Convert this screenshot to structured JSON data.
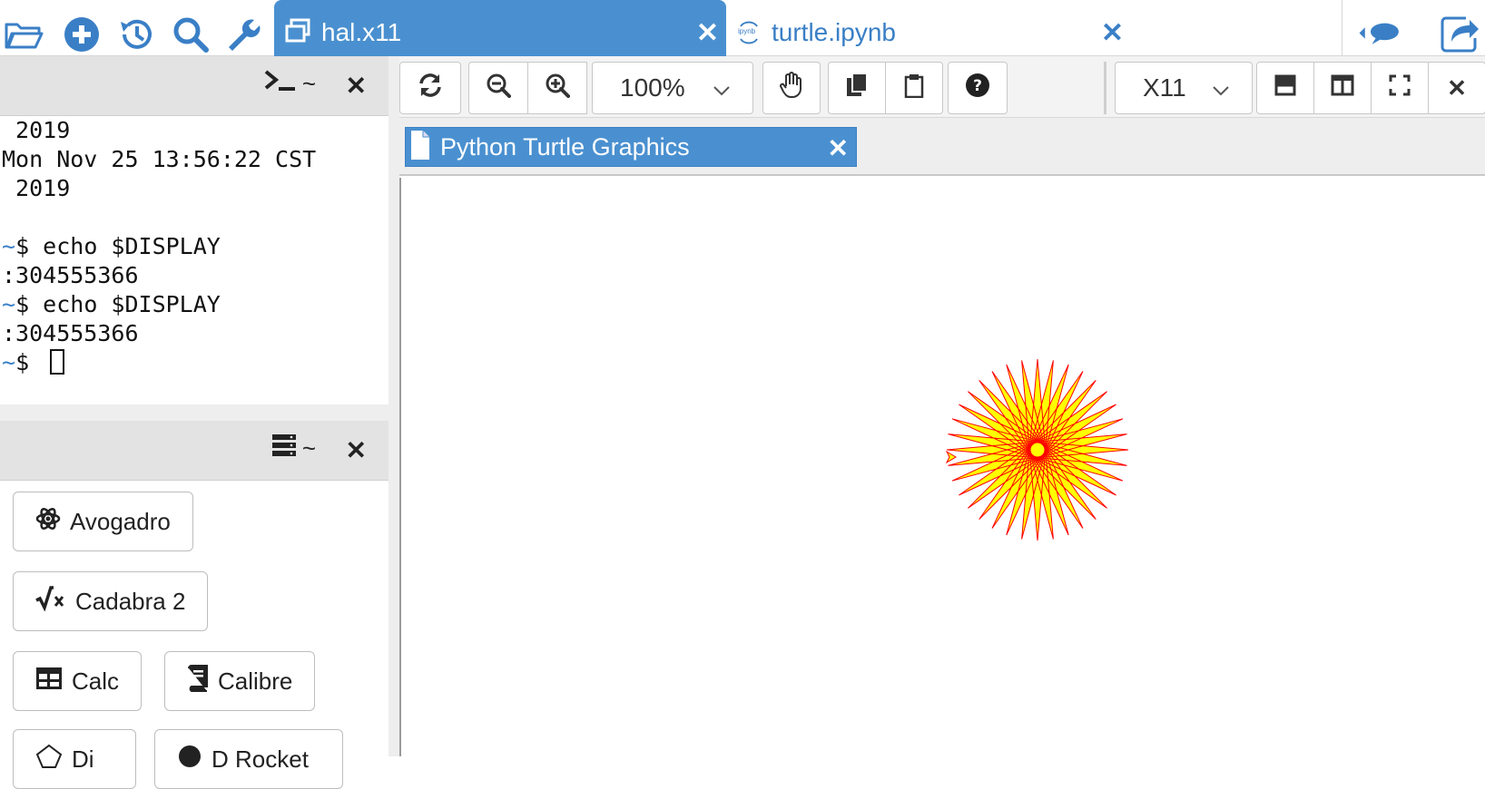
{
  "topbar": {
    "icons": [
      "folder-open-icon",
      "plus-circle-icon",
      "history-icon",
      "search-icon",
      "wrench-icon"
    ],
    "tabs": [
      {
        "label": "hal.x11",
        "icon": "window-icon",
        "active": true
      },
      {
        "label": "turtle.ipynb",
        "icon": "ipynb-icon",
        "active": false
      }
    ],
    "right_icons": [
      "chat-icon",
      "share-icon"
    ],
    "ipynb_badge": "ipynb"
  },
  "terminal_frame": {
    "title": "~",
    "lines": [
      " 2019",
      "Mon Nov 25 13:56:22 CST",
      " 2019",
      "",
      "$ echo $DISPLAY",
      ":304555366",
      "$ echo $DISPLAY",
      ":304555366",
      "$ "
    ]
  },
  "launcher_frame": {
    "title": "~",
    "apps": [
      {
        "label": "Avogadro",
        "icon": "atom-icon"
      },
      {
        "label": "Cadabra 2",
        "icon": "sqrt-icon"
      },
      {
        "label": "Calc",
        "icon": "table-icon"
      },
      {
        "label": "Calibre",
        "icon": "book-icon"
      },
      {
        "label": "Di",
        "icon": "dia-icon"
      },
      {
        "label": "D Rocket",
        "icon": "circle-icon"
      }
    ]
  },
  "toolbar": {
    "zoom": "100%",
    "display_type": "X11"
  },
  "x11": {
    "window_tab_label": "Python Turtle Graphics",
    "colors": {
      "fill": "#ffff00",
      "stroke": "#ff0000"
    }
  }
}
